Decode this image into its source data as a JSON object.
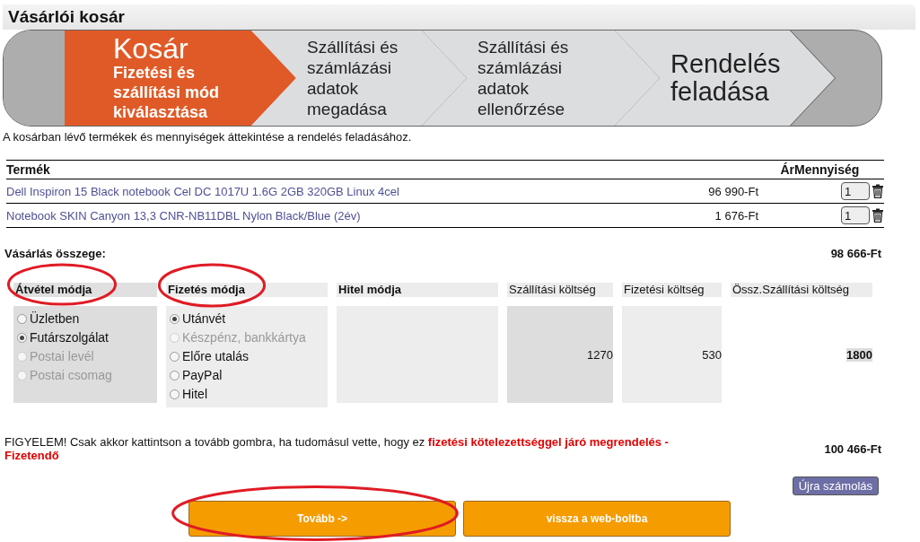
{
  "page_title": "Vásárlói kosár",
  "steps": [
    {
      "kind": "heading",
      "title": "Kosár",
      "subtitle": "Fizetési és szállítási mód kiválasztása",
      "selected": true
    },
    {
      "kind": "text",
      "title": "Szállítási és számlázási adatok megadása",
      "selected": false
    },
    {
      "kind": "text",
      "title": "Szállítási és számlázási adatok ellenőrzése",
      "selected": false
    },
    {
      "kind": "heading",
      "title": "Rendelés feladása",
      "selected": false
    }
  ],
  "intro": "A kosárban lévő termékek és mennyiségek áttekintése a rendelés feladásához.",
  "table": {
    "columns": [
      "Termék",
      "Ár",
      "Mennyiség"
    ],
    "rows": [
      {
        "product": "Dell Inspiron 15 Black notebook Cel DC 1017U 1.6G 2GB 320GB Linux 4cel",
        "price": "96 990-Ft",
        "quantity": "1"
      },
      {
        "product": "Notebook SKIN Canyon 13,3 CNR-NB11DBL Nylon Black/Blue (2év)",
        "price": "1 676-Ft",
        "quantity": "1"
      }
    ]
  },
  "subtotal": {
    "label": "Vásárlás összege:",
    "value": "98 666-Ft"
  },
  "sections": [
    {
      "kind": "options",
      "title": "Átvétel módja",
      "circled": true,
      "options": [
        {
          "label": "Üzletben",
          "selected": false,
          "disabled": false
        },
        {
          "label": "Futárszolgálat",
          "selected": true,
          "disabled": false
        },
        {
          "label": "Postai levél",
          "selected": false,
          "disabled": true
        },
        {
          "label": "Postai csomag",
          "selected": false,
          "disabled": true
        }
      ]
    },
    {
      "kind": "options",
      "title": "Fizetés módja",
      "circled": true,
      "options": [
        {
          "label": "Utánvét",
          "selected": true,
          "disabled": false
        },
        {
          "label": "Készpénz, bankkártya",
          "selected": false,
          "disabled": true
        },
        {
          "label": "Előre utalás",
          "selected": false,
          "disabled": false
        },
        {
          "label": "PayPal",
          "selected": false,
          "disabled": false
        },
        {
          "label": "Hitel",
          "selected": false,
          "disabled": false
        }
      ]
    },
    {
      "kind": "empty",
      "title": "Hitel módja",
      "circled": false
    },
    {
      "kind": "cost",
      "title": "Szállítási költség",
      "circled": false,
      "value": "1270"
    },
    {
      "kind": "cost",
      "title": "Fizetési költség",
      "circled": false,
      "value": "530"
    },
    {
      "kind": "total",
      "title": "Össz.Szállítási költség",
      "circled": false,
      "value": "1800"
    }
  ],
  "warning": "FIGYELEM! Csak akkor kattintson a tovább gombra, ha tudomásul vette, hogy ez **fizetési kötelezettséggel járó megrendelés - Fizetendő**",
  "grand_total": "100 466-Ft",
  "recalculate_button": "Újra számolás",
  "buttons": [
    {
      "label": "Tovább ->",
      "circled": true
    },
    {
      "label": "vissza a web-boltba",
      "circled": false
    }
  ]
}
